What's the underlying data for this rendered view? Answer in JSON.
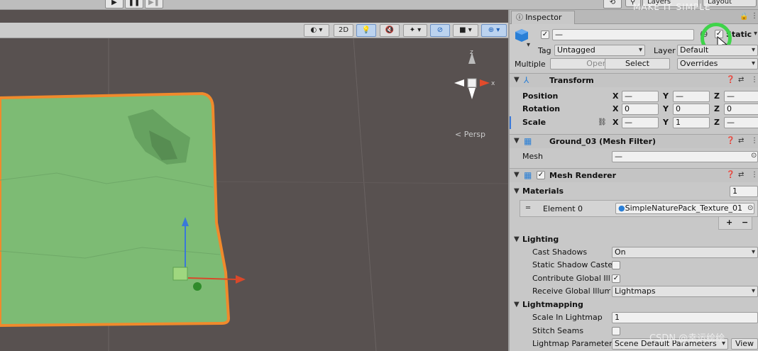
{
  "topbar": {
    "layers_label": "Layers",
    "layout_label": "Layout",
    "overlay_text": "MAKE IT SIMPLE"
  },
  "scene_toolbar": {
    "mode_2d": "2D",
    "persp_label": "< Persp"
  },
  "inspector": {
    "tab_label": "Inspector",
    "object": {
      "name_value": "—",
      "name_suffix": "(9",
      "static_label": "Static",
      "tag_label": "Tag",
      "tag_value": "Untagged",
      "layer_label": "Layer",
      "layer_value": "Default",
      "multiple_label": "Multiple",
      "open_label": "Open",
      "select_label": "Select",
      "overrides_label": "Overrides"
    },
    "transform": {
      "title": "Transform",
      "rows": [
        {
          "label": "Position",
          "x": "—",
          "y": "—",
          "z": "—"
        },
        {
          "label": "Rotation",
          "x": "0",
          "y": "0",
          "z": "0"
        },
        {
          "label": "Scale",
          "x": "—",
          "y": "1",
          "z": "—"
        }
      ],
      "axis_x": "X",
      "axis_y": "Y",
      "axis_z": "Z"
    },
    "mesh_filter": {
      "title": "Ground_03 (Mesh Filter)",
      "mesh_label": "Mesh",
      "mesh_value": "—"
    },
    "mesh_renderer": {
      "title": "Mesh Renderer",
      "materials_label": "Materials",
      "materials_count": "1",
      "element_label": "Element 0",
      "element_value": "SimpleNaturePack_Texture_01",
      "plus": "+",
      "minus": "−",
      "lighting_label": "Lighting",
      "cast_shadows_label": "Cast Shadows",
      "cast_shadows_value": "On",
      "static_shadow_label": "Static Shadow Caste",
      "contribute_gi_label": "Contribute Global Illu",
      "receive_gi_label": "Receive Global Illumi",
      "receive_gi_value": "Lightmaps",
      "lightmapping_label": "Lightmapping",
      "scale_lightmap_label": "Scale In Lightmap",
      "scale_lightmap_value": "1",
      "stitch_seams_label": "Stitch Seams",
      "lightmap_params_label": "Lightmap Parameters",
      "lightmap_params_value": "Scene Default Parameters",
      "view_label": "View"
    }
  },
  "watermark": "CSDN @幸运绘绘",
  "colors": {
    "scene_bg": "#585150",
    "terrain_fill": "#7dbb74",
    "selection_outline": "#f08a2c",
    "highlight_ring": "#3fd44a"
  }
}
